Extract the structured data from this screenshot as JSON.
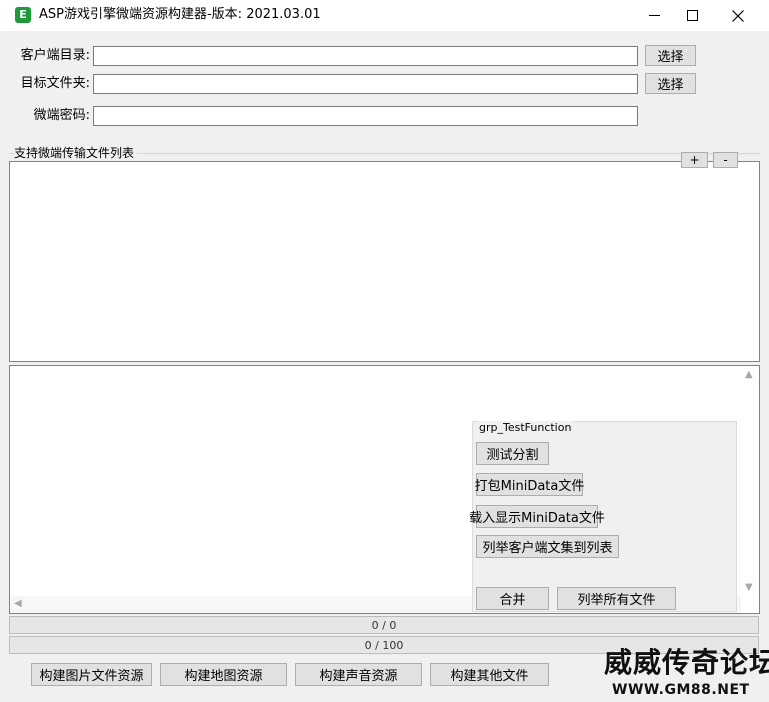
{
  "window": {
    "title": "ASP游戏引擎微端资源构建器-版本: 2021.03.01",
    "app_icon_glyph": "E"
  },
  "form": {
    "client_dir_label": "客户端目录:",
    "client_dir_value": "",
    "target_dir_label": "目标文件夹:",
    "target_dir_value": "",
    "password_label": "微端密码:",
    "password_value": "",
    "browse_label": "选择"
  },
  "file_list": {
    "title": "支持微端传输文件列表",
    "add_label": "+",
    "remove_label": "-"
  },
  "test_group": {
    "title": "grp_TestFunction",
    "buttons": {
      "split": "测试分割",
      "pack_minidata": "打包MiniData文件",
      "load_minidata": "载入显示MiniData文件",
      "list_client": "列举客户端文集到列表",
      "merge": "合并",
      "list_all": "列举所有文件"
    }
  },
  "progress": {
    "bar1_text": "0 / 0",
    "bar2_text": "0 / 100"
  },
  "actions": {
    "build_images": "构建图片文件资源",
    "build_maps": "构建地图资源",
    "build_sounds": "构建声音资源",
    "build_others": "构建其他文件"
  },
  "watermark": {
    "text": "威威传奇论坛",
    "url": "WWW.GM88.NET"
  },
  "icons": {
    "window_icon": "app-logo-icon",
    "minimize": "minimize-icon",
    "maximize": "maximize-icon",
    "close": "close-icon",
    "scroll_up": "scroll-up-icon",
    "scroll_down": "scroll-down-icon",
    "scroll_left": "scroll-left-icon"
  }
}
